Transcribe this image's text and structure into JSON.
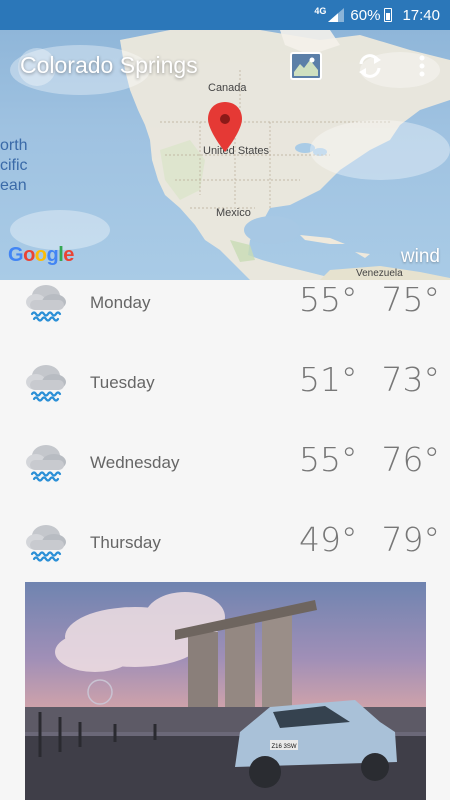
{
  "status_bar": {
    "network": "4G",
    "battery": "60%",
    "time": "17:40"
  },
  "header": {
    "city": "Colorado Springs",
    "icons": [
      "map-layers-icon",
      "refresh-icon",
      "more-vert-icon"
    ]
  },
  "map": {
    "labels": {
      "canada": "Canada",
      "usa": "United States",
      "mexico": "Mexico",
      "venezuela": "Venezuela"
    },
    "ocean_text": [
      "orth",
      "cific",
      "ean"
    ],
    "google": [
      "G",
      "o",
      "o",
      "g",
      "l",
      "e"
    ],
    "overlay_label": "wind",
    "colors": {
      "water": "#a9cbe6",
      "land": "#f2eee6",
      "pin": "#e53935"
    }
  },
  "forecast": [
    {
      "day": "Monday",
      "low": "55°",
      "high": "75°",
      "icon": "rain-cloud-icon"
    },
    {
      "day": "Tuesday",
      "low": "51°",
      "high": "73°",
      "icon": "rain-cloud-icon"
    },
    {
      "day": "Wednesday",
      "low": "55°",
      "high": "76°",
      "icon": "rain-cloud-icon"
    },
    {
      "day": "Thursday",
      "low": "49°",
      "high": "79°",
      "icon": "rain-cloud-icon"
    }
  ],
  "advertisement": {
    "plate": "Z16 3SW"
  }
}
